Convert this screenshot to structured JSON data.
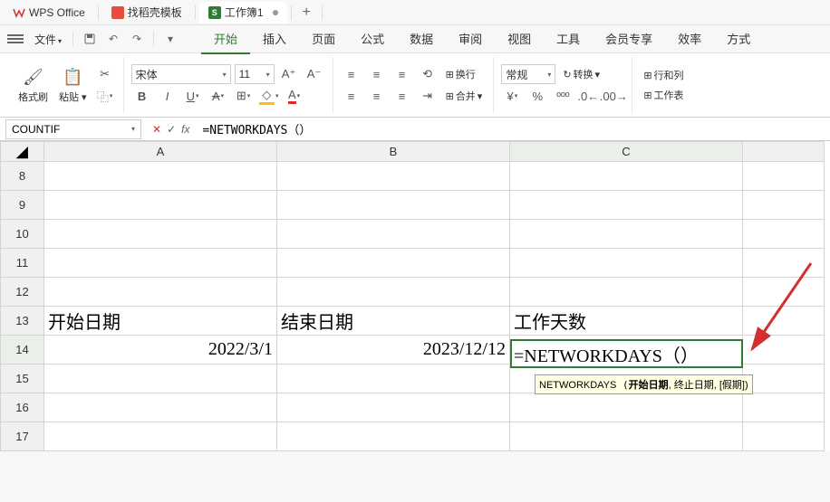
{
  "title_tabs": {
    "wps": "WPS Office",
    "doke": "找稻壳模板",
    "workbook": "工作簿1"
  },
  "menu": {
    "file": "文件",
    "tabs": [
      "开始",
      "插入",
      "页面",
      "公式",
      "数据",
      "审阅",
      "视图",
      "工具",
      "会员专享",
      "效率",
      "方式"
    ]
  },
  "ribbon": {
    "format_painter": "格式刷",
    "paste": "粘贴",
    "font_name": "宋体",
    "font_size": "11",
    "wrap": "换行",
    "merge": "合并",
    "number_format": "常规",
    "convert": "转换",
    "rowcol": "行和列",
    "worksheet": "工作表"
  },
  "formula_bar": {
    "name_box": "COUNTIF",
    "formula": "=NETWORKDAYS（）"
  },
  "grid": {
    "cols": [
      "A",
      "B",
      "C"
    ],
    "rows": [
      "8",
      "9",
      "10",
      "11",
      "12",
      "13",
      "14",
      "15",
      "16",
      "17"
    ],
    "data": {
      "r13": {
        "A": "开始日期",
        "B": "结束日期",
        "C": "工作天数"
      },
      "r14": {
        "A": "2022/3/1",
        "B": "2023/12/12",
        "C": "=NETWORKDAYS（）"
      }
    }
  },
  "tooltip": {
    "fn": "NETWORKDAYS",
    "arg1": "开始日期",
    "rest": ", 终止日期, [假期])"
  }
}
